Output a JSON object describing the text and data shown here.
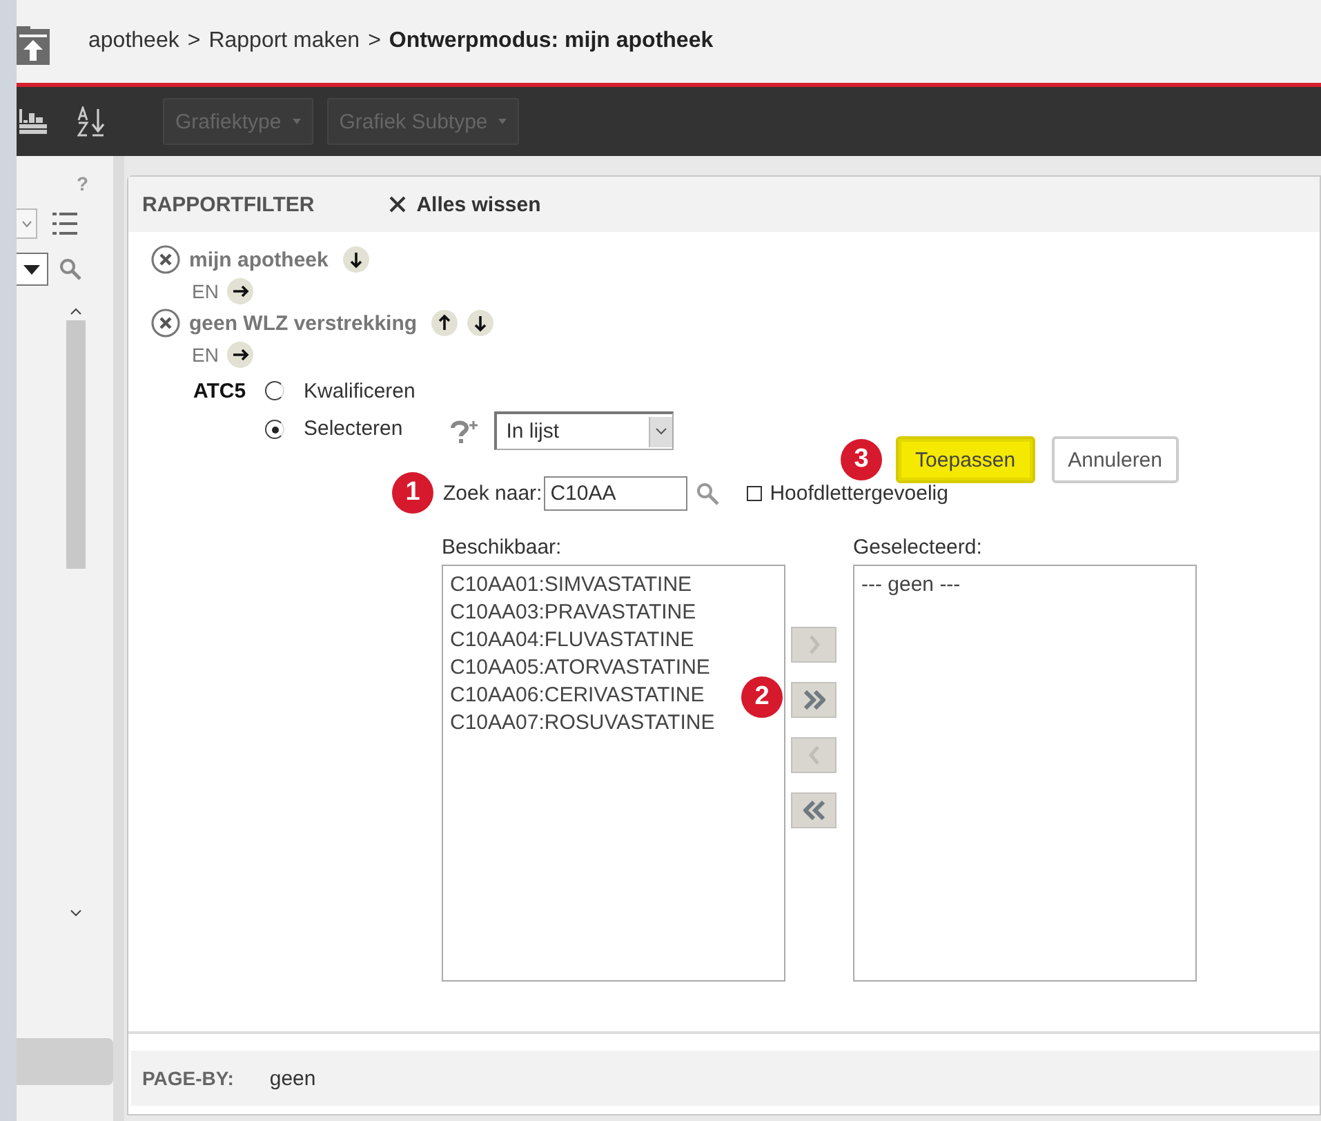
{
  "breadcrumb": [
    {
      "kind": "link",
      "text": "apotheek"
    },
    {
      "kind": "separator",
      "text": ">"
    },
    {
      "kind": "link",
      "text": "Rapport maken"
    },
    {
      "kind": "separator",
      "text": ">"
    },
    {
      "kind": "current",
      "text": "Ontwerpmodus: mijn apotheek"
    }
  ],
  "toolbar": {
    "dropdowns": [
      {
        "label": "Grafiektype",
        "disabled": true
      },
      {
        "label": "Grafiek Subtype",
        "disabled": true
      }
    ]
  },
  "sidebar": {
    "help": "?"
  },
  "filter": {
    "title": "RAPPORTFILTER",
    "clear_label": "Alles wissen",
    "conditions": [
      {
        "name": "mijn apotheek",
        "move_up": false,
        "move_down": true,
        "connector": "EN"
      },
      {
        "name": "geen WLZ verstrekking",
        "move_up": true,
        "move_down": true,
        "connector": "EN"
      }
    ],
    "editor": {
      "attribute": "ATC5",
      "modes": [
        {
          "label": "Kwalificeren",
          "selected": false
        },
        {
          "label": "Selecteren",
          "selected": true
        }
      ],
      "operator": "In lijst",
      "search_label": "Zoek naar:",
      "search_value": "C10AA",
      "case_sensitive": {
        "label": "Hoofdlettergevoelig",
        "checked": false
      },
      "available_label": "Beschikbaar:",
      "available": [
        "C10AA01:SIMVASTATINE",
        "C10AA03:PRAVASTATINE",
        "C10AA04:FLUVASTATINE",
        "C10AA05:ATORVASTATINE",
        "C10AA06:CERIVASTATINE",
        "C10AA07:ROSUVASTATINE"
      ],
      "selected_label": "Geselecteerd:",
      "selected_items": [
        "--- geen ---"
      ],
      "transfer_buttons": [
        {
          "kind": "add",
          "disabled": true
        },
        {
          "kind": "add_all",
          "disabled": false
        },
        {
          "kind": "remove",
          "disabled": true
        },
        {
          "kind": "remove_all",
          "disabled": false
        }
      ],
      "apply": "Toepassen",
      "cancel": "Annuleren"
    },
    "callouts": [
      {
        "text": "1"
      },
      {
        "text": "2"
      },
      {
        "text": "3"
      }
    ]
  },
  "page_by": {
    "label": "PAGE-BY:",
    "value": "geen"
  }
}
